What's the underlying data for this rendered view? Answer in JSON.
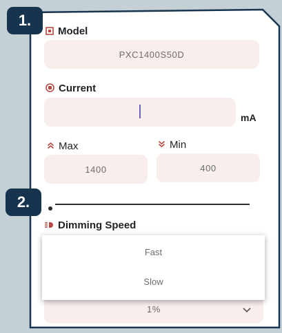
{
  "badges": {
    "step1": "1.",
    "step2": "2."
  },
  "model": {
    "label": "Model",
    "value": "PXC1400S50D"
  },
  "current": {
    "label": "Current",
    "value": "",
    "unit": "mA"
  },
  "max": {
    "label": "Max",
    "value": "1400"
  },
  "min": {
    "label": "Min",
    "value": "400"
  },
  "dimming": {
    "label": "Dimming Speed",
    "options": [
      "Fast",
      "Slow"
    ],
    "selected": "1%"
  },
  "colors": {
    "badge": "#16344d",
    "field_bg": "#f8eeec",
    "icon_accent": "#b6483f",
    "caret": "#6b63c4"
  },
  "icons": {
    "model": "chip-icon",
    "current": "gauge-icon",
    "max": "double-chevron-up-icon",
    "min": "double-chevron-down-icon",
    "dimming": "dimming-icon",
    "select": "chevron-down-icon"
  }
}
